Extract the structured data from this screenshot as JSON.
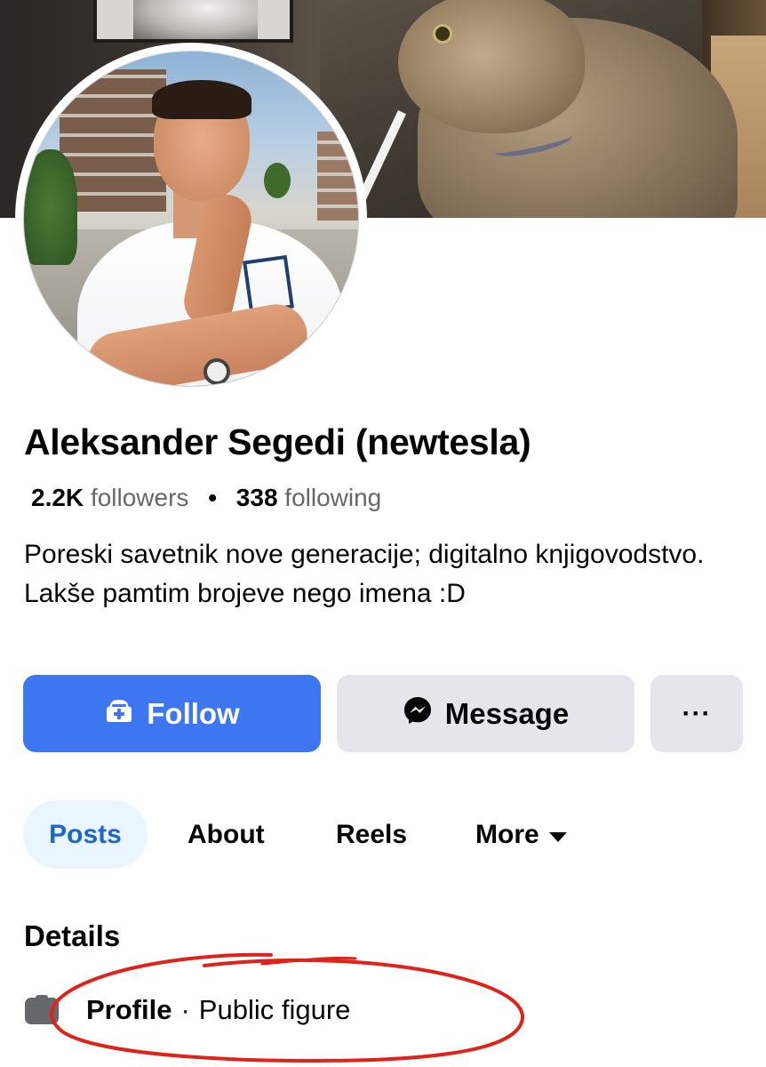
{
  "profile": {
    "name": "Aleksander Segedi (newtesla)",
    "followers_count": "2.2K",
    "followers_label": "followers",
    "separator": "•",
    "following_count": "338",
    "following_label": "following",
    "bio": "Poreski savetnik nove generacije; digitalno knjigovodstvo. Lakše pamtim brojeve nego imena :D"
  },
  "actions": {
    "follow_label": "Follow",
    "message_label": "Message",
    "more_label": "···"
  },
  "tabs": [
    {
      "label": "Posts",
      "active": true
    },
    {
      "label": "About",
      "active": false
    },
    {
      "label": "Reels",
      "active": false
    },
    {
      "label": "More",
      "active": false
    }
  ],
  "details": {
    "heading": "Details",
    "category_key": "Profile",
    "category_sep": "·",
    "category_value": "Public figure"
  },
  "colors": {
    "primary": "#3c76f0",
    "secondary_button": "#e4e6eb",
    "active_tab_bg": "#ebf5ff",
    "active_tab_text": "#1b68c9",
    "muted_text": "#65676b",
    "annotation": "#e0231a"
  },
  "icons": {
    "follow": "add-friend-icon",
    "message": "messenger-icon",
    "more_tab": "caret-down-icon",
    "details_row": "profile-badge-icon"
  }
}
